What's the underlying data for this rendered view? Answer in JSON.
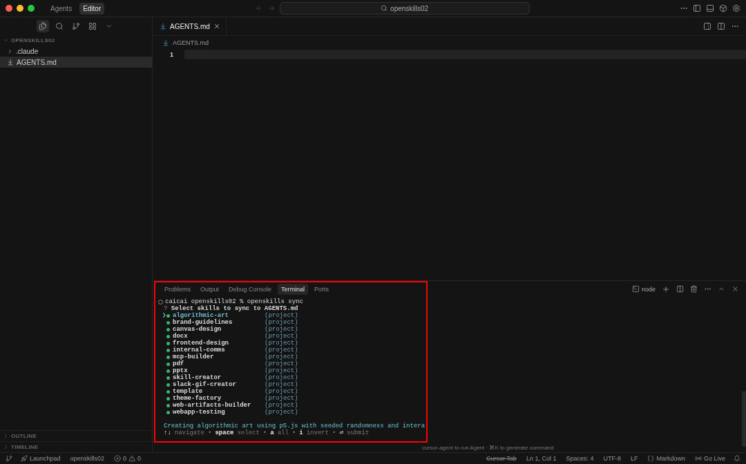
{
  "title_bar": {
    "modes": [
      {
        "label": "Agents",
        "selected": false
      },
      {
        "label": "Editor",
        "selected": true
      }
    ],
    "search": "openskills02"
  },
  "sidebar": {
    "project": "OPENSKILLS02",
    "tree": [
      {
        "label": ".claude",
        "kind": "folder",
        "expanded": false,
        "selected": false
      },
      {
        "label": "AGENTS.md",
        "kind": "file",
        "selected": true
      }
    ],
    "sections": [
      "OUTLINE",
      "TIMELINE"
    ]
  },
  "editor": {
    "tab": "AGENTS.md",
    "breadcrumb": "AGENTS.md",
    "line_numbers": [
      "1"
    ]
  },
  "panel": {
    "tabs": [
      {
        "label": "Problems",
        "selected": false
      },
      {
        "label": "Output",
        "selected": false
      },
      {
        "label": "Debug Console",
        "selected": false
      },
      {
        "label": "Terminal",
        "selected": true
      },
      {
        "label": "Ports",
        "selected": false
      }
    ],
    "profile": "node",
    "terminal": {
      "prompt": "caicai openskills02 % openskills sync",
      "question_mark": "?",
      "question": "Select skills to sync to AGENTS.md",
      "cursor": "❯",
      "skills": [
        {
          "name": "algorithmic-art",
          "tag": "(project)",
          "selected": true
        },
        {
          "name": "brand-guidelines",
          "tag": "(project)",
          "selected": false
        },
        {
          "name": "canvas-design",
          "tag": "(project)",
          "selected": false
        },
        {
          "name": "docx",
          "tag": "(project)",
          "selected": false
        },
        {
          "name": "frontend-design",
          "tag": "(project)",
          "selected": false
        },
        {
          "name": "internal-comms",
          "tag": "(project)",
          "selected": false
        },
        {
          "name": "mcp-builder",
          "tag": "(project)",
          "selected": false
        },
        {
          "name": "pdf",
          "tag": "(project)",
          "selected": false
        },
        {
          "name": "pptx",
          "tag": "(project)",
          "selected": false
        },
        {
          "name": "skill-creator",
          "tag": "(project)",
          "selected": false
        },
        {
          "name": "slack-gif-creator",
          "tag": "(project)",
          "selected": false
        },
        {
          "name": "template",
          "tag": "(project)",
          "selected": false
        },
        {
          "name": "theme-factory",
          "tag": "(project)",
          "selected": false
        },
        {
          "name": "web-artifacts-builder",
          "tag": "(project)",
          "selected": false
        },
        {
          "name": "webapp-testing",
          "tag": "(project)",
          "selected": false
        }
      ],
      "description": "Creating algorithmic art using p5.js with seeded randomness and intera",
      "help": [
        {
          "kind": "key",
          "text": "↑↓"
        },
        {
          "kind": "label",
          "text": "navigate"
        },
        {
          "kind": "sep",
          "text": "•"
        },
        {
          "kind": "key",
          "text": "space"
        },
        {
          "kind": "label",
          "text": "select"
        },
        {
          "kind": "sep",
          "text": "•"
        },
        {
          "kind": "key",
          "text": "a"
        },
        {
          "kind": "label",
          "text": "all"
        },
        {
          "kind": "sep",
          "text": "•"
        },
        {
          "kind": "key",
          "text": "i"
        },
        {
          "kind": "label",
          "text": "invert"
        },
        {
          "kind": "sep",
          "text": "•"
        },
        {
          "kind": "key",
          "text": "⏎"
        },
        {
          "kind": "label",
          "text": "submit"
        }
      ]
    },
    "hint": "cursor-agent to run Agent · ⌘K to generate command"
  },
  "status_bar": {
    "launchpad": "Launchpad",
    "branch": "openskills02",
    "errors": "0",
    "warnings": "0",
    "right": [
      {
        "label": "Cursor Tab",
        "struck": true,
        "kind": "plain"
      },
      {
        "label": "Ln 1, Col 1",
        "struck": false,
        "kind": "plain"
      },
      {
        "label": "Spaces: 4",
        "struck": false,
        "kind": "plain"
      },
      {
        "label": "UTF-8",
        "struck": false,
        "kind": "plain"
      },
      {
        "label": "LF",
        "struck": false,
        "kind": "plain"
      },
      {
        "label": "Markdown",
        "struck": false,
        "kind": "language"
      },
      {
        "label": "Go Live",
        "struck": false,
        "kind": "live"
      }
    ]
  }
}
